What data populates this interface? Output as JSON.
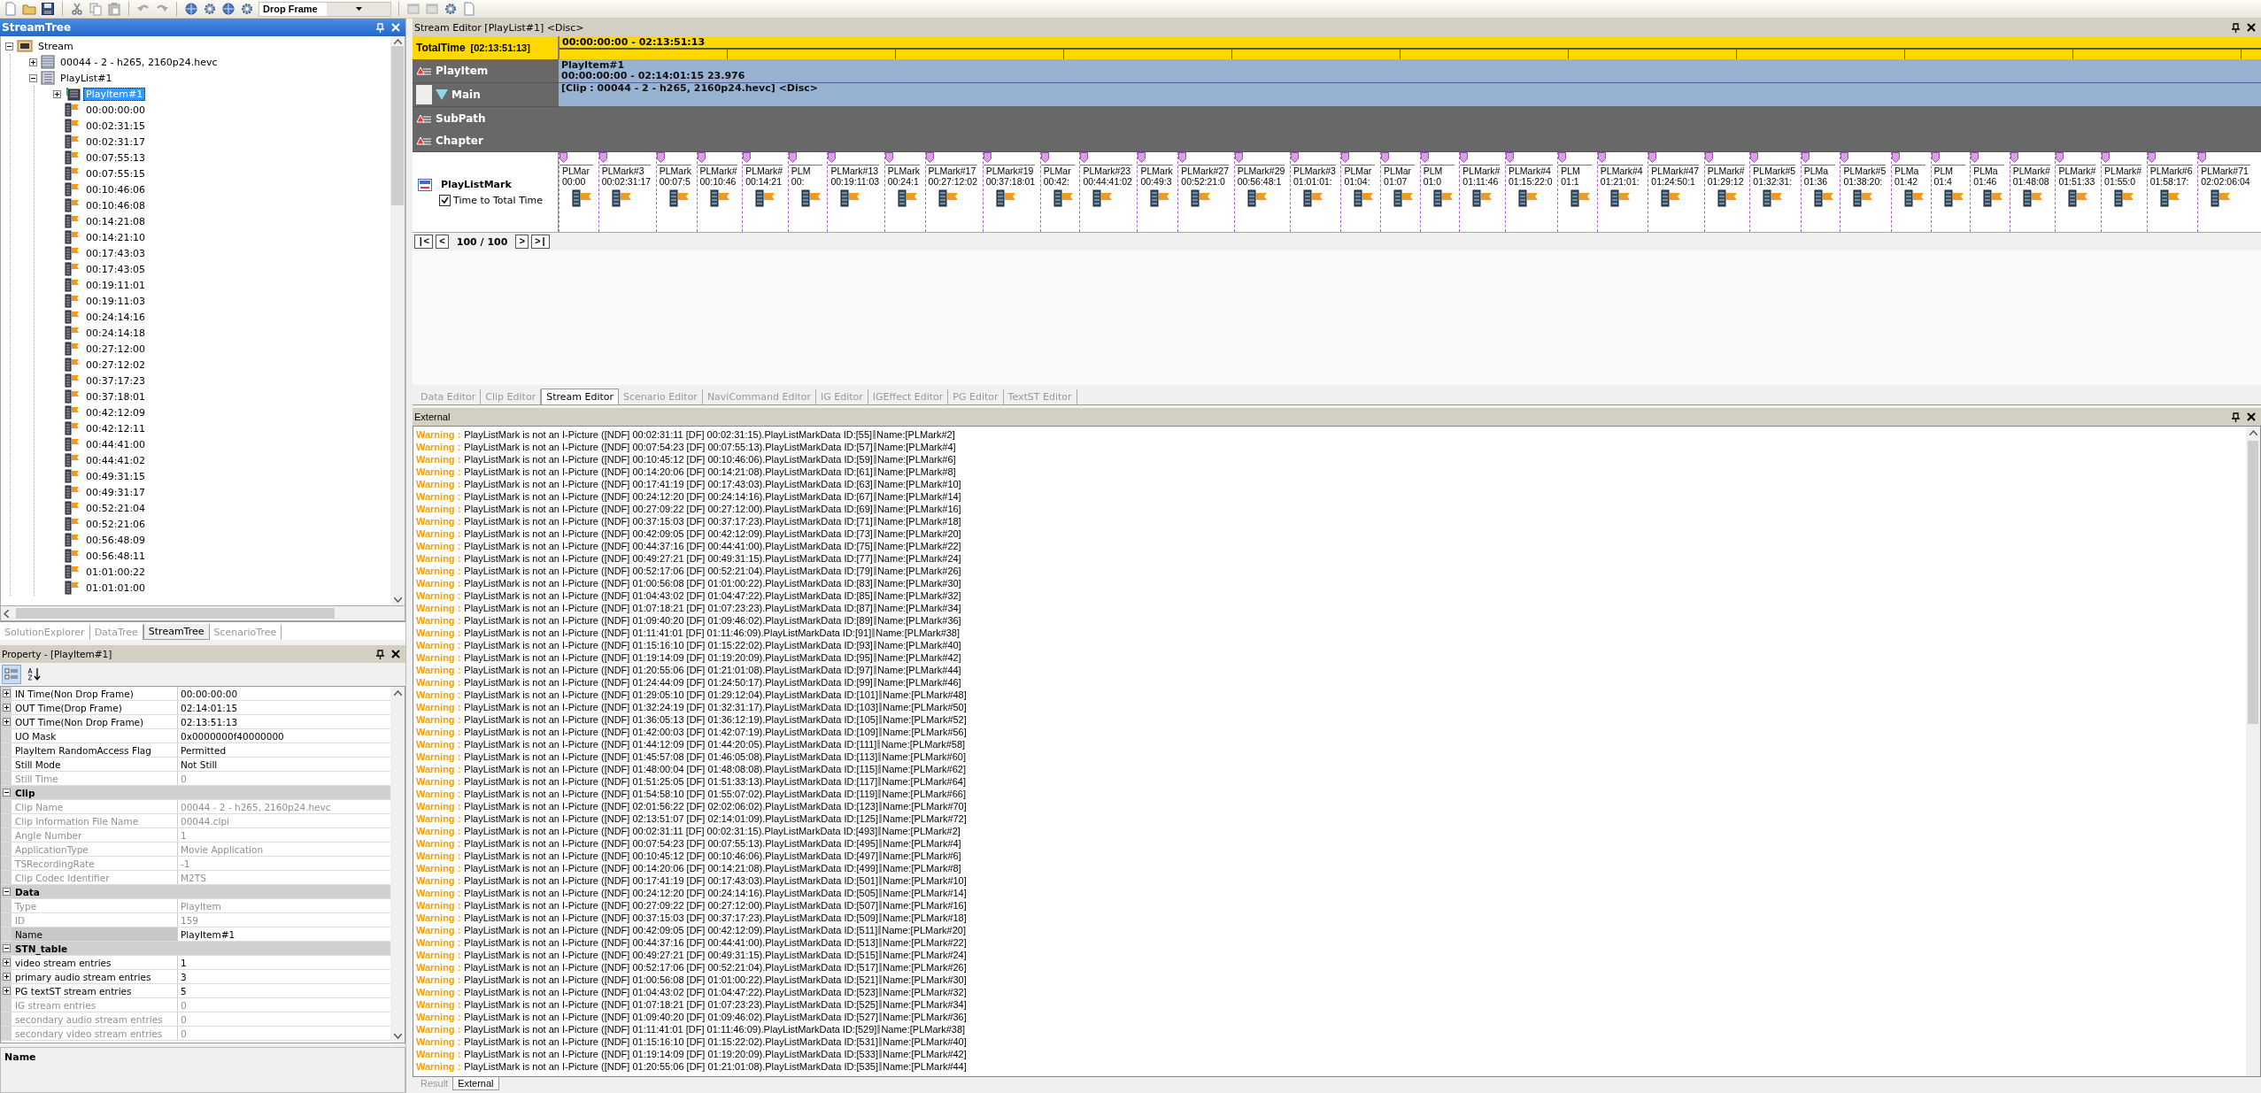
{
  "toolbar": {
    "timecode_mode": "Drop Frame"
  },
  "stream_tree": {
    "title": "StreamTree",
    "items": [
      {
        "kind": "stream",
        "label": "Stream",
        "expanded": true,
        "selected": false,
        "children": [
          {
            "kind": "clip",
            "label": "00044 - 2 - h265, 2160p24.hevc",
            "expanded": false,
            "selected": false
          },
          {
            "kind": "playlist",
            "label": "PlayList#1",
            "expanded": true,
            "selected": false,
            "children": [
              {
                "kind": "playitem",
                "label": "PlayItem#1",
                "expanded": false,
                "selected": true
              },
              {
                "kind": "mark",
                "label": "00:00:00:00",
                "selected": false
              },
              {
                "kind": "mark",
                "label": "00:02:31:15",
                "selected": false
              },
              {
                "kind": "mark",
                "label": "00:02:31:17",
                "selected": false
              },
              {
                "kind": "mark",
                "label": "00:07:55:13",
                "selected": false
              },
              {
                "kind": "mark",
                "label": "00:07:55:15",
                "selected": false
              },
              {
                "kind": "mark",
                "label": "00:10:46:06",
                "selected": false
              },
              {
                "kind": "mark",
                "label": "00:10:46:08",
                "selected": false
              },
              {
                "kind": "mark",
                "label": "00:14:21:08",
                "selected": false
              },
              {
                "kind": "mark",
                "label": "00:14:21:10",
                "selected": false
              },
              {
                "kind": "mark",
                "label": "00:17:43:03",
                "selected": false
              },
              {
                "kind": "mark",
                "label": "00:17:43:05",
                "selected": false
              },
              {
                "kind": "mark",
                "label": "00:19:11:01",
                "selected": false
              },
              {
                "kind": "mark",
                "label": "00:19:11:03",
                "selected": false
              },
              {
                "kind": "mark",
                "label": "00:24:14:16",
                "selected": false
              },
              {
                "kind": "mark",
                "label": "00:24:14:18",
                "selected": false
              },
              {
                "kind": "mark",
                "label": "00:27:12:00",
                "selected": false
              },
              {
                "kind": "mark",
                "label": "00:27:12:02",
                "selected": false
              },
              {
                "kind": "mark",
                "label": "00:37:17:23",
                "selected": false
              },
              {
                "kind": "mark",
                "label": "00:37:18:01",
                "selected": false
              },
              {
                "kind": "mark",
                "label": "00:42:12:09",
                "selected": false
              },
              {
                "kind": "mark",
                "label": "00:42:12:11",
                "selected": false
              },
              {
                "kind": "mark",
                "label": "00:44:41:00",
                "selected": false
              },
              {
                "kind": "mark",
                "label": "00:44:41:02",
                "selected": false
              },
              {
                "kind": "mark",
                "label": "00:49:31:15",
                "selected": false
              },
              {
                "kind": "mark",
                "label": "00:49:31:17",
                "selected": false
              },
              {
                "kind": "mark",
                "label": "00:52:21:04",
                "selected": false
              },
              {
                "kind": "mark",
                "label": "00:52:21:06",
                "selected": false
              },
              {
                "kind": "mark",
                "label": "00:56:48:09",
                "selected": false
              },
              {
                "kind": "mark",
                "label": "00:56:48:11",
                "selected": false
              },
              {
                "kind": "mark",
                "label": "01:01:00:22",
                "selected": false
              },
              {
                "kind": "mark",
                "label": "01:01:01:00",
                "selected": false
              }
            ]
          }
        ]
      }
    ],
    "tabs": [
      {
        "label": "SolutionExplorer",
        "selected": false
      },
      {
        "label": "DataTree",
        "selected": false
      },
      {
        "label": "StreamTree",
        "selected": true
      },
      {
        "label": "ScenarioTree",
        "selected": false
      }
    ]
  },
  "property": {
    "title": "Property - [PlayItem#1]",
    "view_buttons": [
      {
        "kind": "categorized",
        "selected": true
      },
      {
        "kind": "alphabetical",
        "selected": false
      }
    ],
    "rows": [
      {
        "kind": "property",
        "label": "IN Time(Non Drop Frame)",
        "value": "00:00:00:00",
        "expandable": true,
        "disabled": false,
        "selected": false
      },
      {
        "kind": "property",
        "label": "OUT Time(Drop Frame)",
        "value": "02:14:01:15",
        "expandable": true,
        "disabled": false,
        "selected": false
      },
      {
        "kind": "property",
        "label": "OUT Time(Non Drop Frame)",
        "value": "02:13:51:13",
        "expandable": true,
        "disabled": false,
        "selected": false
      },
      {
        "kind": "property",
        "label": "UO Mask",
        "value": "0x0000000f40000000",
        "expandable": false,
        "disabled": false,
        "selected": false
      },
      {
        "kind": "property",
        "label": "PlayItem RandomAccess Flag",
        "value": "Permitted",
        "expandable": false,
        "disabled": false,
        "selected": false
      },
      {
        "kind": "property",
        "label": "Still Mode",
        "value": "Not Still",
        "expandable": false,
        "disabled": false,
        "selected": false
      },
      {
        "kind": "property",
        "label": "Still Time",
        "value": "0",
        "expandable": false,
        "disabled": true,
        "selected": false
      },
      {
        "kind": "category",
        "label": "Clip",
        "expanded": true
      },
      {
        "kind": "property",
        "label": "Clip Name",
        "value": "00044 - 2 - h265, 2160p24.hevc",
        "expandable": false,
        "disabled": true,
        "selected": false
      },
      {
        "kind": "property",
        "label": "Clip Information File Name",
        "value": "00044.clpi",
        "expandable": false,
        "disabled": true,
        "selected": false
      },
      {
        "kind": "property",
        "label": "Angle Number",
        "value": "1",
        "expandable": false,
        "disabled": true,
        "selected": false
      },
      {
        "kind": "property",
        "label": "ApplicationType",
        "value": "Movie Application",
        "expandable": false,
        "disabled": true,
        "selected": false
      },
      {
        "kind": "property",
        "label": "TSRecordingRate",
        "value": "-1",
        "expandable": false,
        "disabled": true,
        "selected": false
      },
      {
        "kind": "property",
        "label": "Clip Codec Identifier",
        "value": "M2TS",
        "expandable": false,
        "disabled": true,
        "selected": false
      },
      {
        "kind": "category",
        "label": "Data",
        "expanded": true
      },
      {
        "kind": "property",
        "label": "Type",
        "value": "PlayItem",
        "expandable": false,
        "disabled": true,
        "selected": false
      },
      {
        "kind": "property",
        "label": "ID",
        "value": "159",
        "expandable": false,
        "disabled": true,
        "selected": false
      },
      {
        "kind": "property",
        "label": "Name",
        "value": "PlayItem#1",
        "expandable": false,
        "disabled": false,
        "selected": true
      },
      {
        "kind": "category",
        "label": "STN_table",
        "expanded": true
      },
      {
        "kind": "property",
        "label": "video stream entries",
        "value": "1",
        "expandable": true,
        "disabled": false,
        "selected": false
      },
      {
        "kind": "property",
        "label": "primary audio stream entries",
        "value": "3",
        "expandable": true,
        "disabled": false,
        "selected": false
      },
      {
        "kind": "property",
        "label": "PG textST stream entries",
        "value": "5",
        "expandable": true,
        "disabled": false,
        "selected": false
      },
      {
        "kind": "property",
        "label": "IG stream entries",
        "value": "0",
        "expandable": false,
        "disabled": true,
        "selected": false
      },
      {
        "kind": "property",
        "label": "secondary audio stream entries",
        "value": "0",
        "expandable": false,
        "disabled": true,
        "selected": false
      },
      {
        "kind": "property",
        "label": "secondary video stream entries",
        "value": "0",
        "expandable": false,
        "disabled": true,
        "selected": false
      }
    ],
    "description": "Name"
  },
  "stream_editor": {
    "title": "Stream Editor [PlayList#1] <Disc>",
    "total_time": {
      "label": "TotalTime",
      "value": "[02:13:51:13]",
      "range": "00:00:00:00 - 02:13:51:13"
    },
    "play_item": {
      "label": "PlayItem",
      "name": "PlayItem#1",
      "detail": "00:00:00:00 - 02:14:01:15  23.976"
    },
    "main": {
      "label": "Main",
      "clip": "[Clip : 00044 - 2 - h265, 2160p24.hevc] <Disc>"
    },
    "sub_path": {
      "label": "SubPath"
    },
    "chapter": {
      "label": "Chapter"
    },
    "marks_label": "PlayListMark",
    "time_to_total": {
      "label": "Time to Total Time",
      "checked": true
    },
    "marks": [
      {
        "name": "PLMar",
        "time": "00:00"
      },
      {
        "name": "PLMark#3",
        "time": "00:02:31:17"
      },
      {
        "name": "PLMark",
        "time": "00:07:5"
      },
      {
        "name": "PLMark#",
        "time": "00:10:46"
      },
      {
        "name": "PLMark#",
        "time": "00:14:21"
      },
      {
        "name": "PLM",
        "time": "00:"
      },
      {
        "name": "PLMark#13",
        "time": "00:19:11:03"
      },
      {
        "name": "PLMark",
        "time": "00:24:1"
      },
      {
        "name": "PLMark#17",
        "time": "00:27:12:02"
      },
      {
        "name": "PLMark#19",
        "time": "00:37:18:01"
      },
      {
        "name": "PLMar",
        "time": "00:42:"
      },
      {
        "name": "PLMark#23",
        "time": "00:44:41:02"
      },
      {
        "name": "PLMark",
        "time": "00:49:3"
      },
      {
        "name": "PLMark#27",
        "time": "00:52:21:0"
      },
      {
        "name": "PLMark#29",
        "time": "00:56:48:1"
      },
      {
        "name": "PLMark#3",
        "time": "01:01:01:"
      },
      {
        "name": "PLMar",
        "time": "01:04:"
      },
      {
        "name": "PLMar",
        "time": "01:07"
      },
      {
        "name": "PLM",
        "time": "01:0"
      },
      {
        "name": "PLMark#",
        "time": "01:11:46"
      },
      {
        "name": "PLMark#4",
        "time": "01:15:22:0"
      },
      {
        "name": "PLM",
        "time": "01:1"
      },
      {
        "name": "PLMark#4",
        "time": "01:21:01:"
      },
      {
        "name": "PLMark#47",
        "time": "01:24:50:1"
      },
      {
        "name": "PLMark#",
        "time": "01:29:12"
      },
      {
        "name": "PLMark#5",
        "time": "01:32:31:"
      },
      {
        "name": "PLMa",
        "time": "01:36"
      },
      {
        "name": "PLMark#5",
        "time": "01:38:20:"
      },
      {
        "name": "PLMa",
        "time": "01:42"
      },
      {
        "name": "PLM",
        "time": "01:4"
      },
      {
        "name": "PLMa",
        "time": "01:46"
      },
      {
        "name": "PLMark#",
        "time": "01:48:08"
      },
      {
        "name": "PLMark#",
        "time": "01:51:33"
      },
      {
        "name": "PLMark#",
        "time": "01:55:0"
      },
      {
        "name": "PLMark#6",
        "time": "01:58:17:"
      },
      {
        "name": "PLMark#71",
        "time": "02:02:06:04"
      }
    ],
    "nav": {
      "first": "|<",
      "prev": "<",
      "page": "100 / 100",
      "next": ">",
      "last": ">|"
    }
  },
  "editor_tabs": [
    {
      "label": "Data Editor",
      "selected": false
    },
    {
      "label": "Clip Editor",
      "selected": false
    },
    {
      "label": "Stream Editor",
      "selected": true
    },
    {
      "label": "Scenario Editor",
      "selected": false
    },
    {
      "label": "NaviCommand Editor",
      "selected": false
    },
    {
      "label": "IG Editor",
      "selected": false
    },
    {
      "label": "IGEffect Editor",
      "selected": false
    },
    {
      "label": "PG Editor",
      "selected": false
    },
    {
      "label": "TextST Editor",
      "selected": false
    }
  ],
  "output": {
    "title": "External",
    "entries": [
      {
        "label": "Warning :",
        "message": "PlayListMark is not an I-Picture ([NDF] 00:02:31:11  [DF] 00:02:31:15).PlayListMarkData ID:[55]",
        "name": "Name:[PLMark#2]"
      },
      {
        "label": "Warning :",
        "message": "PlayListMark is not an I-Picture ([NDF] 00:07:54:23  [DF] 00:07:55:13).PlayListMarkData ID:[57]",
        "name": "Name:[PLMark#4]"
      },
      {
        "label": "Warning :",
        "message": "PlayListMark is not an I-Picture ([NDF] 00:10:45:12  [DF] 00:10:46:06).PlayListMarkData ID:[59]",
        "name": "Name:[PLMark#6]"
      },
      {
        "label": "Warning :",
        "message": "PlayListMark is not an I-Picture ([NDF] 00:14:20:06  [DF] 00:14:21:08).PlayListMarkData ID:[61]",
        "name": "Name:[PLMark#8]"
      },
      {
        "label": "Warning :",
        "message": "PlayListMark is not an I-Picture ([NDF] 00:17:41:19  [DF] 00:17:43:03).PlayListMarkData ID:[63]",
        "name": "Name:[PLMark#10]"
      },
      {
        "label": "Warning :",
        "message": "PlayListMark is not an I-Picture ([NDF] 00:24:12:20  [DF] 00:24:14:16).PlayListMarkData ID:[67]",
        "name": "Name:[PLMark#14]"
      },
      {
        "label": "Warning :",
        "message": "PlayListMark is not an I-Picture ([NDF] 00:27:09:22  [DF] 00:27:12:00).PlayListMarkData ID:[69]",
        "name": "Name:[PLMark#16]"
      },
      {
        "label": "Warning :",
        "message": "PlayListMark is not an I-Picture ([NDF] 00:37:15:03  [DF] 00:37:17:23).PlayListMarkData ID:[71]",
        "name": "Name:[PLMark#18]"
      },
      {
        "label": "Warning :",
        "message": "PlayListMark is not an I-Picture ([NDF] 00:42:09:05  [DF] 00:42:12:09).PlayListMarkData ID:[73]",
        "name": "Name:[PLMark#20]"
      },
      {
        "label": "Warning :",
        "message": "PlayListMark is not an I-Picture ([NDF] 00:44:37:16  [DF] 00:44:41:00).PlayListMarkData ID:[75]",
        "name": "Name:[PLMark#22]"
      },
      {
        "label": "Warning :",
        "message": "PlayListMark is not an I-Picture ([NDF] 00:49:27:21  [DF] 00:49:31:15).PlayListMarkData ID:[77]",
        "name": "Name:[PLMark#24]"
      },
      {
        "label": "Warning :",
        "message": "PlayListMark is not an I-Picture ([NDF] 00:52:17:06  [DF] 00:52:21:04).PlayListMarkData ID:[79]",
        "name": "Name:[PLMark#26]"
      },
      {
        "label": "Warning :",
        "message": "PlayListMark is not an I-Picture ([NDF] 01:00:56:08  [DF] 01:01:00:22).PlayListMarkData ID:[83]",
        "name": "Name:[PLMark#30]"
      },
      {
        "label": "Warning :",
        "message": "PlayListMark is not an I-Picture ([NDF] 01:04:43:02  [DF] 01:04:47:22).PlayListMarkData ID:[85]",
        "name": "Name:[PLMark#32]"
      },
      {
        "label": "Warning :",
        "message": "PlayListMark is not an I-Picture ([NDF] 01:07:18:21  [DF] 01:07:23:23).PlayListMarkData ID:[87]",
        "name": "Name:[PLMark#34]"
      },
      {
        "label": "Warning :",
        "message": "PlayListMark is not an I-Picture ([NDF] 01:09:40:20  [DF] 01:09:46:02).PlayListMarkData ID:[89]",
        "name": "Name:[PLMark#36]"
      },
      {
        "label": "Warning :",
        "message": "PlayListMark is not an I-Picture ([NDF] 01:11:41:01  [DF] 01:11:46:09).PlayListMarkData ID:[91]",
        "name": "Name:[PLMark#38]"
      },
      {
        "label": "Warning :",
        "message": "PlayListMark is not an I-Picture ([NDF] 01:15:16:10  [DF] 01:15:22:02).PlayListMarkData ID:[93]",
        "name": "Name:[PLMark#40]"
      },
      {
        "label": "Warning :",
        "message": "PlayListMark is not an I-Picture ([NDF] 01:19:14:09  [DF] 01:19:20:09).PlayListMarkData ID:[95]",
        "name": "Name:[PLMark#42]"
      },
      {
        "label": "Warning :",
        "message": "PlayListMark is not an I-Picture ([NDF] 01:20:55:06  [DF] 01:21:01:08).PlayListMarkData ID:[97]",
        "name": "Name:[PLMark#44]"
      },
      {
        "label": "Warning :",
        "message": "PlayListMark is not an I-Picture ([NDF] 01:24:44:09  [DF] 01:24:50:17).PlayListMarkData ID:[99]",
        "name": "Name:[PLMark#46]"
      },
      {
        "label": "Warning :",
        "message": "PlayListMark is not an I-Picture ([NDF] 01:29:05:10  [DF] 01:29:12:04).PlayListMarkData ID:[101]",
        "name": "Name:[PLMark#48]"
      },
      {
        "label": "Warning :",
        "message": "PlayListMark is not an I-Picture ([NDF] 01:32:24:19  [DF] 01:32:31:17).PlayListMarkData ID:[103]",
        "name": "Name:[PLMark#50]"
      },
      {
        "label": "Warning :",
        "message": "PlayListMark is not an I-Picture ([NDF] 01:36:05:13  [DF] 01:36:12:19).PlayListMarkData ID:[105]",
        "name": "Name:[PLMark#52]"
      },
      {
        "label": "Warning :",
        "message": "PlayListMark is not an I-Picture ([NDF] 01:42:00:03  [DF] 01:42:07:19).PlayListMarkData ID:[109]",
        "name": "Name:[PLMark#56]"
      },
      {
        "label": "Warning :",
        "message": "PlayListMark is not an I-Picture ([NDF] 01:44:12:09  [DF] 01:44:20:05).PlayListMarkData ID:[111]",
        "name": "Name:[PLMark#58]"
      },
      {
        "label": "Warning :",
        "message": "PlayListMark is not an I-Picture ([NDF] 01:45:57:08  [DF] 01:46:05:08).PlayListMarkData ID:[113]",
        "name": "Name:[PLMark#60]"
      },
      {
        "label": "Warning :",
        "message": "PlayListMark is not an I-Picture ([NDF] 01:48:00:04  [DF] 01:48:08:08).PlayListMarkData ID:[115]",
        "name": "Name:[PLMark#62]"
      },
      {
        "label": "Warning :",
        "message": "PlayListMark is not an I-Picture ([NDF] 01:51:25:05  [DF] 01:51:33:13).PlayListMarkData ID:[117]",
        "name": "Name:[PLMark#64]"
      },
      {
        "label": "Warning :",
        "message": "PlayListMark is not an I-Picture ([NDF] 01:54:58:10  [DF] 01:55:07:02).PlayListMarkData ID:[119]",
        "name": "Name:[PLMark#66]"
      },
      {
        "label": "Warning :",
        "message": "PlayListMark is not an I-Picture ([NDF] 02:01:56:22  [DF] 02:02:06:02).PlayListMarkData ID:[123]",
        "name": "Name:[PLMark#70]"
      },
      {
        "label": "Warning :",
        "message": "PlayListMark is not an I-Picture ([NDF] 02:13:51:07  [DF] 02:14:01:09).PlayListMarkData ID:[125]",
        "name": "Name:[PLMark#72]"
      },
      {
        "label": "Warning :",
        "message": "PlayListMark is not an I-Picture ([NDF] 00:02:31:11  [DF] 00:02:31:15).PlayListMarkData ID:[493]",
        "name": "Name:[PLMark#2]"
      },
      {
        "label": "Warning :",
        "message": "PlayListMark is not an I-Picture ([NDF] 00:07:54:23  [DF] 00:07:55:13).PlayListMarkData ID:[495]",
        "name": "Name:[PLMark#4]"
      },
      {
        "label": "Warning :",
        "message": "PlayListMark is not an I-Picture ([NDF] 00:10:45:12  [DF] 00:10:46:06).PlayListMarkData ID:[497]",
        "name": "Name:[PLMark#6]"
      },
      {
        "label": "Warning :",
        "message": "PlayListMark is not an I-Picture ([NDF] 00:14:20:06  [DF] 00:14:21:08).PlayListMarkData ID:[499]",
        "name": "Name:[PLMark#8]"
      },
      {
        "label": "Warning :",
        "message": "PlayListMark is not an I-Picture ([NDF] 00:17:41:19  [DF] 00:17:43:03).PlayListMarkData ID:[501]",
        "name": "Name:[PLMark#10]"
      },
      {
        "label": "Warning :",
        "message": "PlayListMark is not an I-Picture ([NDF] 00:24:12:20  [DF] 00:24:14:16).PlayListMarkData ID:[505]",
        "name": "Name:[PLMark#14]"
      },
      {
        "label": "Warning :",
        "message": "PlayListMark is not an I-Picture ([NDF] 00:27:09:22  [DF] 00:27:12:00).PlayListMarkData ID:[507]",
        "name": "Name:[PLMark#16]"
      },
      {
        "label": "Warning :",
        "message": "PlayListMark is not an I-Picture ([NDF] 00:37:15:03  [DF] 00:37:17:23).PlayListMarkData ID:[509]",
        "name": "Name:[PLMark#18]"
      },
      {
        "label": "Warning :",
        "message": "PlayListMark is not an I-Picture ([NDF] 00:42:09:05  [DF] 00:42:12:09).PlayListMarkData ID:[511]",
        "name": "Name:[PLMark#20]"
      },
      {
        "label": "Warning :",
        "message": "PlayListMark is not an I-Picture ([NDF] 00:44:37:16  [DF] 00:44:41:00).PlayListMarkData ID:[513]",
        "name": "Name:[PLMark#22]"
      },
      {
        "label": "Warning :",
        "message": "PlayListMark is not an I-Picture ([NDF] 00:49:27:21  [DF] 00:49:31:15).PlayListMarkData ID:[515]",
        "name": "Name:[PLMark#24]"
      },
      {
        "label": "Warning :",
        "message": "PlayListMark is not an I-Picture ([NDF] 00:52:17:06  [DF] 00:52:21:04).PlayListMarkData ID:[517]",
        "name": "Name:[PLMark#26]"
      },
      {
        "label": "Warning :",
        "message": "PlayListMark is not an I-Picture ([NDF] 01:00:56:08  [DF] 01:01:00:22).PlayListMarkData ID:[521]",
        "name": "Name:[PLMark#30]"
      },
      {
        "label": "Warning :",
        "message": "PlayListMark is not an I-Picture ([NDF] 01:04:43:02  [DF] 01:04:47:22).PlayListMarkData ID:[523]",
        "name": "Name:[PLMark#32]"
      },
      {
        "label": "Warning :",
        "message": "PlayListMark is not an I-Picture ([NDF] 01:07:18:21  [DF] 01:07:23:23).PlayListMarkData ID:[525]",
        "name": "Name:[PLMark#34]"
      },
      {
        "label": "Warning :",
        "message": "PlayListMark is not an I-Picture ([NDF] 01:09:40:20  [DF] 01:09:46:02).PlayListMarkData ID:[527]",
        "name": "Name:[PLMark#36]"
      },
      {
        "label": "Warning :",
        "message": "PlayListMark is not an I-Picture ([NDF] 01:11:41:01  [DF] 01:11:46:09).PlayListMarkData ID:[529]",
        "name": "Name:[PLMark#38]"
      },
      {
        "label": "Warning :",
        "message": "PlayListMark is not an I-Picture ([NDF] 01:15:16:10  [DF] 01:15:22:02).PlayListMarkData ID:[531]",
        "name": "Name:[PLMark#40]"
      },
      {
        "label": "Warning :",
        "message": "PlayListMark is not an I-Picture ([NDF] 01:19:14:09  [DF] 01:19:20:09).PlayListMarkData ID:[533]",
        "name": "Name:[PLMark#42]"
      },
      {
        "label": "Warning :",
        "message": "PlayListMark is not an I-Picture ([NDF] 01:20:55:06  [DF] 01:21:01:08).PlayListMarkData ID:[535]",
        "name": "Name:[PLMark#44]"
      }
    ]
  },
  "output_tabs": [
    {
      "label": "Result",
      "selected": false
    },
    {
      "label": "External",
      "selected": true
    }
  ]
}
